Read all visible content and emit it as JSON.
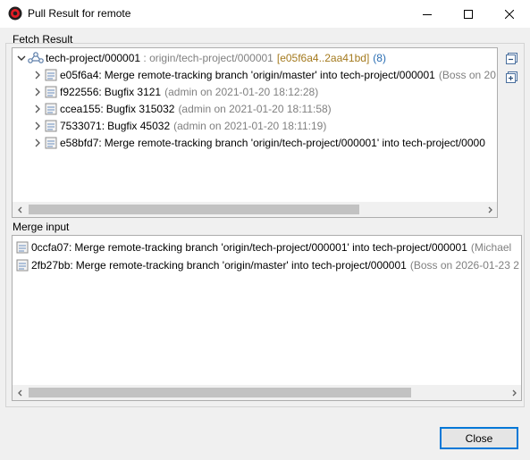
{
  "window": {
    "title": "Pull Result for remote",
    "minimize_icon": "minimize-icon",
    "maximize_icon": "maximize-icon",
    "close_icon": "close-icon"
  },
  "fetch_result": {
    "label": "Fetch Result",
    "root": {
      "name": "tech-project/000001",
      "separator": " : ",
      "remote_ref": "origin/tech-project/000001",
      "range": "[e05f6a4..2aa41bd]",
      "count": "(8)"
    },
    "commits": [
      {
        "id": "e05f6a4:",
        "message": "Merge remote-tracking branch 'origin/master' into tech-project/000001",
        "meta": "(Boss on 20"
      },
      {
        "id": "f922556:",
        "message": "Bugfix 3121",
        "meta": "(admin on 2021-01-20 18:12:28)"
      },
      {
        "id": "ccea155:",
        "message": "Bugfix 315032",
        "meta": "(admin on 2021-01-20 18:11:58)"
      },
      {
        "id": "7533071:",
        "message": "Bugfix 45032",
        "meta": "(admin on 2021-01-20 18:11:19)"
      },
      {
        "id": "e58bfd7:",
        "message": "Merge remote-tracking branch 'origin/tech-project/000001' into tech-project/0000",
        "meta": ""
      }
    ]
  },
  "merge_input": {
    "label": "Merge input",
    "commits": [
      {
        "id": "0ccfa07:",
        "message": "Merge remote-tracking branch 'origin/tech-project/000001' into tech-project/000001",
        "meta": "(Michael"
      },
      {
        "id": "2fb27bb:",
        "message": "Merge remote-tracking branch 'origin/master' into tech-project/000001",
        "meta": "(Boss on 2026-01-23 2"
      }
    ]
  },
  "buttons": {
    "close_label": "Close",
    "collapse_all_icon": "collapse-all-icon",
    "expand_all_icon": "expand-all-icon"
  },
  "colors": {
    "accent": "#0078d7",
    "ref_range": "#a47a1e",
    "count": "#2a6eb3",
    "meta": "#808080"
  }
}
